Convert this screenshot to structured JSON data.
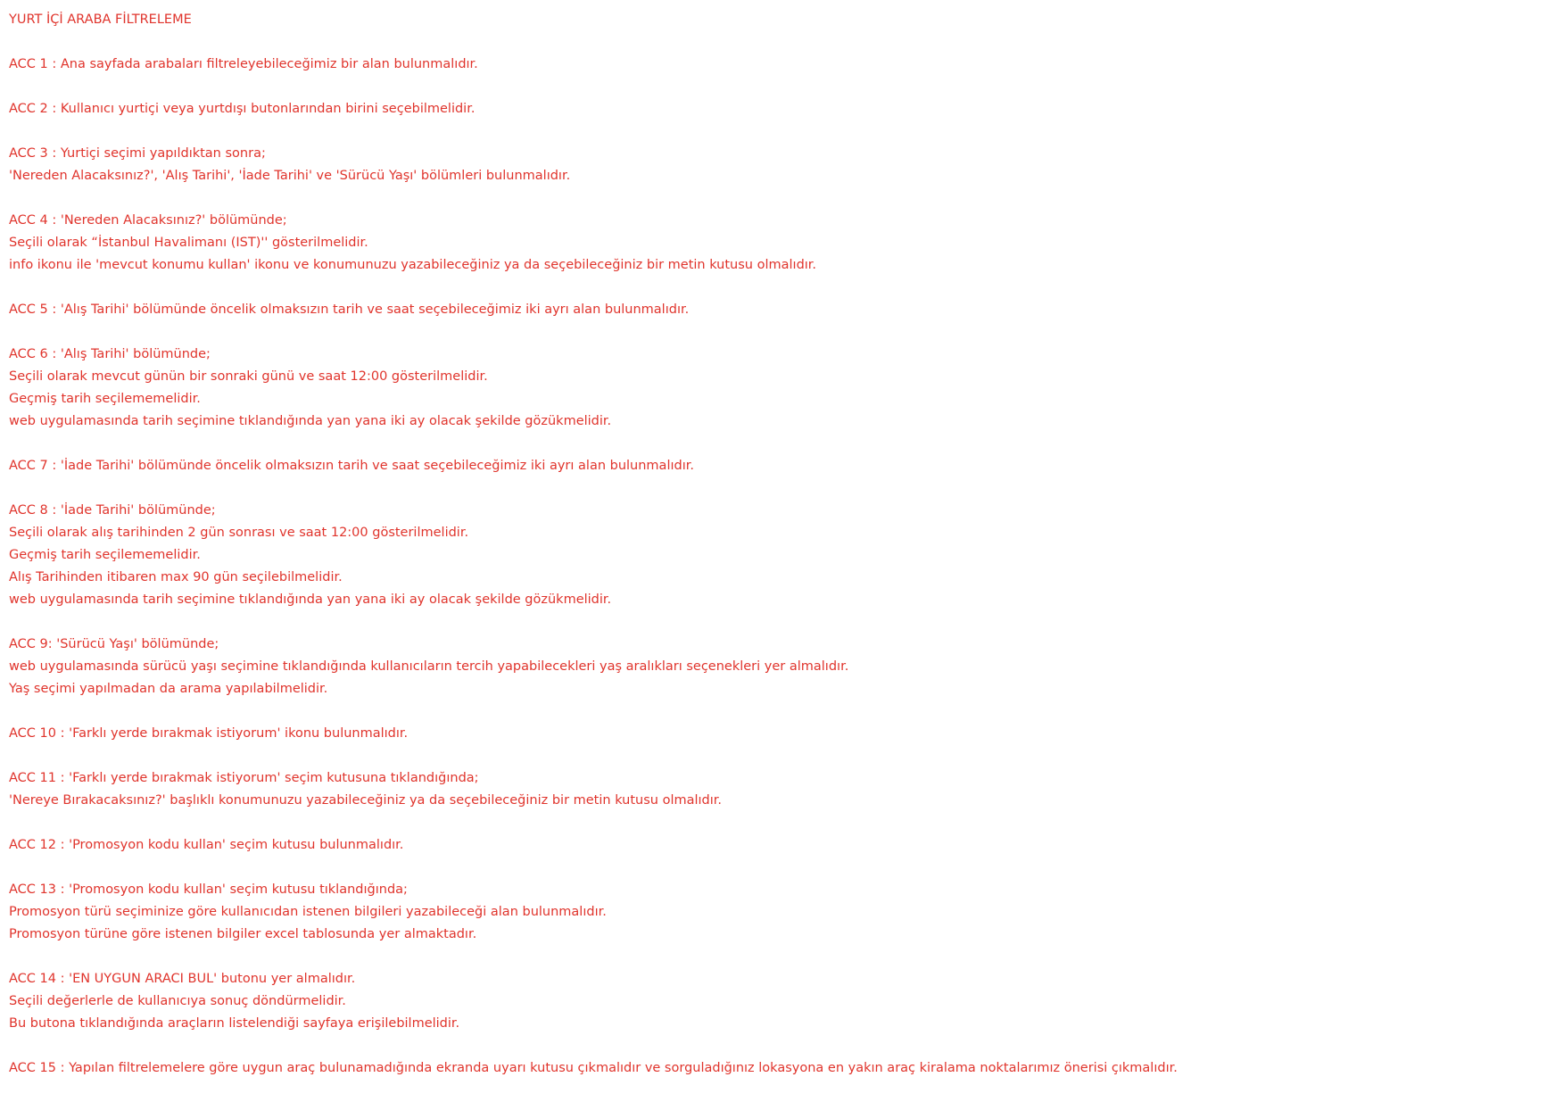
{
  "document": {
    "title": "YURT İÇİ ARABA FİLTRELEME",
    "text_color": "#e0342c",
    "blocks": [
      {
        "lines": [
          "ACC 1 : Ana sayfada arabaları filtreleyebileceğimiz bir alan bulunmalıdır."
        ]
      },
      {
        "lines": [
          "ACC 2 : Kullanıcı yurtiçi veya yurtdışı butonlarından birini seçebilmelidir."
        ]
      },
      {
        "lines": [
          "ACC 3 : Yurtiçi seçimi yapıldıktan sonra;",
          "'Nereden Alacaksınız?', 'Alış Tarihi', 'İade Tarihi' ve 'Sürücü Yaşı' bölümleri bulunmalıdır."
        ]
      },
      {
        "lines": [
          "ACC 4 : 'Nereden Alacaksınız?' bölümünde;",
          "Seçili olarak “İstanbul Havalimanı (IST)'' gösterilmelidir.",
          "info ikonu ile 'mevcut konumu kullan' ikonu ve konumunuzu yazabileceğiniz ya da seçebileceğiniz bir metin kutusu olmalıdır."
        ]
      },
      {
        "lines": [
          "ACC 5 : 'Alış Tarihi' bölümünde öncelik olmaksızın tarih ve saat seçebileceğimiz iki ayrı alan bulunmalıdır."
        ]
      },
      {
        "lines": [
          "ACC 6 : 'Alış Tarihi' bölümünde;",
          "Seçili olarak mevcut günün bir sonraki günü ve saat 12:00 gösterilmelidir.",
          "Geçmiş tarih seçilememelidir.",
          "web uygulamasında tarih seçimine tıklandığında yan yana iki ay olacak şekilde gözükmelidir."
        ]
      },
      {
        "lines": [
          "ACC 7 : 'İade Tarihi' bölümünde öncelik olmaksızın tarih ve saat seçebileceğimiz iki ayrı alan bulunmalıdır."
        ]
      },
      {
        "lines": [
          "ACC 8 : 'İade Tarihi' bölümünde;",
          "Seçili olarak alış tarihinden 2 gün sonrası ve saat 12:00 gösterilmelidir.",
          "Geçmiş tarih seçilememelidir.",
          "Alış Tarihinden itibaren max 90 gün seçilebilmelidir.",
          "web uygulamasında tarih seçimine tıklandığında yan yana iki ay olacak şekilde gözükmelidir."
        ]
      },
      {
        "lines": [
          "ACC 9: 'Sürücü Yaşı' bölümünde;",
          "web uygulamasında sürücü yaşı seçimine tıklandığında kullanıcıların tercih yapabilecekleri yaş aralıkları seçenekleri yer almalıdır.",
          "Yaş seçimi yapılmadan da arama yapılabilmelidir."
        ]
      },
      {
        "lines": [
          "ACC 10 : 'Farklı yerde bırakmak istiyorum' ikonu bulunmalıdır."
        ]
      },
      {
        "lines": [
          "ACC 11 : 'Farklı yerde bırakmak istiyorum' seçim kutusuna tıklandığında;",
          "'Nereye Bırakacaksınız?' başlıklı konumunuzu yazabileceğiniz ya da seçebileceğiniz bir metin kutusu olmalıdır."
        ]
      },
      {
        "lines": [
          "ACC 12 : 'Promosyon kodu kullan' seçim kutusu bulunmalıdır."
        ]
      },
      {
        "lines": [
          "ACC 13 : 'Promosyon kodu kullan' seçim kutusu tıklandığında;",
          "Promosyon türü seçiminize göre kullanıcıdan istenen bilgileri yazabileceği alan bulunmalıdır.",
          "Promosyon türüne göre istenen bilgiler excel tablosunda yer almaktadır."
        ]
      },
      {
        "lines": [
          "ACC 14 : 'EN UYGUN ARACI BUL' butonu yer almalıdır.",
          "Seçili değerlerle de kullanıcıya sonuç döndürmelidir.",
          "Bu butona tıklandığında araçların listelendiği sayfaya erişilebilmelidir."
        ]
      },
      {
        "lines": [
          "ACC 15 : Yapılan filtrelemelere göre uygun araç bulunamadığında ekranda uyarı kutusu çıkmalıdır ve sorguladığınız lokasyona en yakın araç kiralama noktalarımız önerisi çıkmalıdır."
        ]
      }
    ]
  }
}
